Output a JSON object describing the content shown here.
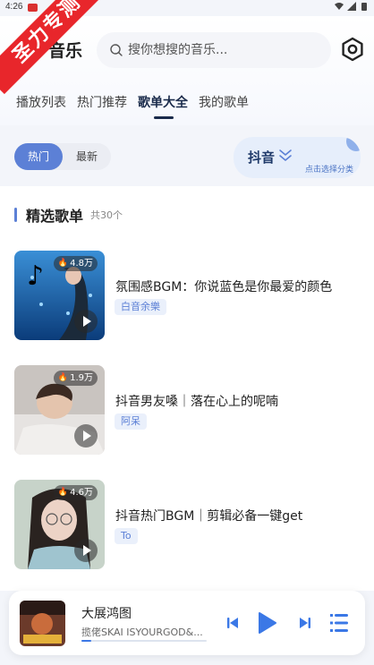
{
  "status": {
    "time": "4:26"
  },
  "watermark": "圣力专测",
  "header": {
    "app_title": "音乐",
    "search_placeholder": "搜你想搜的音乐...",
    "tabs": [
      {
        "label": "播放列表",
        "active": false
      },
      {
        "label": "热门推荐",
        "active": false
      },
      {
        "label": "歌单大全",
        "active": true
      },
      {
        "label": "我的歌单",
        "active": false
      }
    ]
  },
  "filter": {
    "sort_options": [
      {
        "label": "热门",
        "active": true
      },
      {
        "label": "最新",
        "active": false
      }
    ],
    "category": {
      "name": "抖音",
      "hint": "点击选择分类"
    }
  },
  "section": {
    "title": "精选歌单",
    "count": "共30个"
  },
  "playlists": [
    {
      "title": "氛围感BGM：你说蓝色是你最爱的颜色",
      "author": "白音余樂",
      "plays": "4.8万"
    },
    {
      "title": "抖音男友嗓｜落在心上的呢喃",
      "author": "阿呆",
      "plays": "1.9万"
    },
    {
      "title": "抖音热门BGM｜剪辑必备一键get",
      "author": "To",
      "plays": "4.6万"
    }
  ],
  "player": {
    "song": "大展鸿图",
    "artist": "揽佬SKAI ISYOURGOD&...",
    "progress": 0.08
  },
  "colors": {
    "accent": "#5c80d6",
    "player_blue": "#3b78e6",
    "watermark_red": "#e8262b"
  }
}
